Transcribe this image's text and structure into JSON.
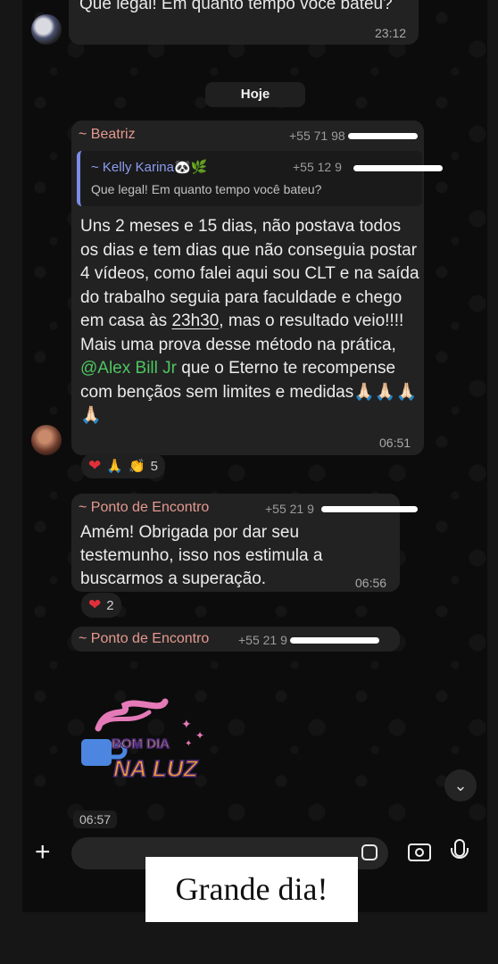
{
  "top_message": {
    "text": "Que legal! Em quanto tempo você bateu?",
    "time": "23:12"
  },
  "day_divider": "Hoje",
  "message_beatriz": {
    "sender": "~ Beatriz",
    "phone": "+55 71 98",
    "quoted": {
      "sender": "~ Kelly Karina🐼🌿",
      "phone": "+55 12 9",
      "text": "Que legal! Em quanto tempo você bateu?"
    },
    "text_1": "Uns 2 meses e 15 dias, não postava todos os dias e tem dias que não conseguia postar 4 vídeos, como falei aqui sou CLT e na saída do trabalho seguia para faculdade e chego em casa às ",
    "time_link": "23h30",
    "text_2": ", mas o resultado veio!!!!",
    "text_3": "Mais uma prova desse método na prática, ",
    "mention": "@Alex Bill Jr",
    "text_4": " que o Eterno te recompense com bençãos sem limites e medidas",
    "emoji_tail": "🙏🏻🙏🏻🙏🏻🙏🏻",
    "time": "06:51",
    "reactions": {
      "emojis": [
        "❤",
        "🙏",
        "👏"
      ],
      "count": "5"
    }
  },
  "message_ponto_1": {
    "sender": "~ Ponto de Encontro",
    "phone": "+55 21 9",
    "text": "Amém! Obrigada por dar seu testemunho, isso nos estimula a buscarmos a superação.",
    "time": "06:56",
    "reactions": {
      "emoji": "❤",
      "count": "2"
    }
  },
  "message_ponto_2": {
    "sender": "~ Ponto de Encontro",
    "phone": "+55 21 9"
  },
  "sticker": {
    "line1": "BOM DIA",
    "line2": "NA LUZ"
  },
  "sticker_time": "06:57",
  "input_bar": {
    "plus_icon": "+",
    "placeholder": ""
  },
  "caption": "Grande dia!"
}
